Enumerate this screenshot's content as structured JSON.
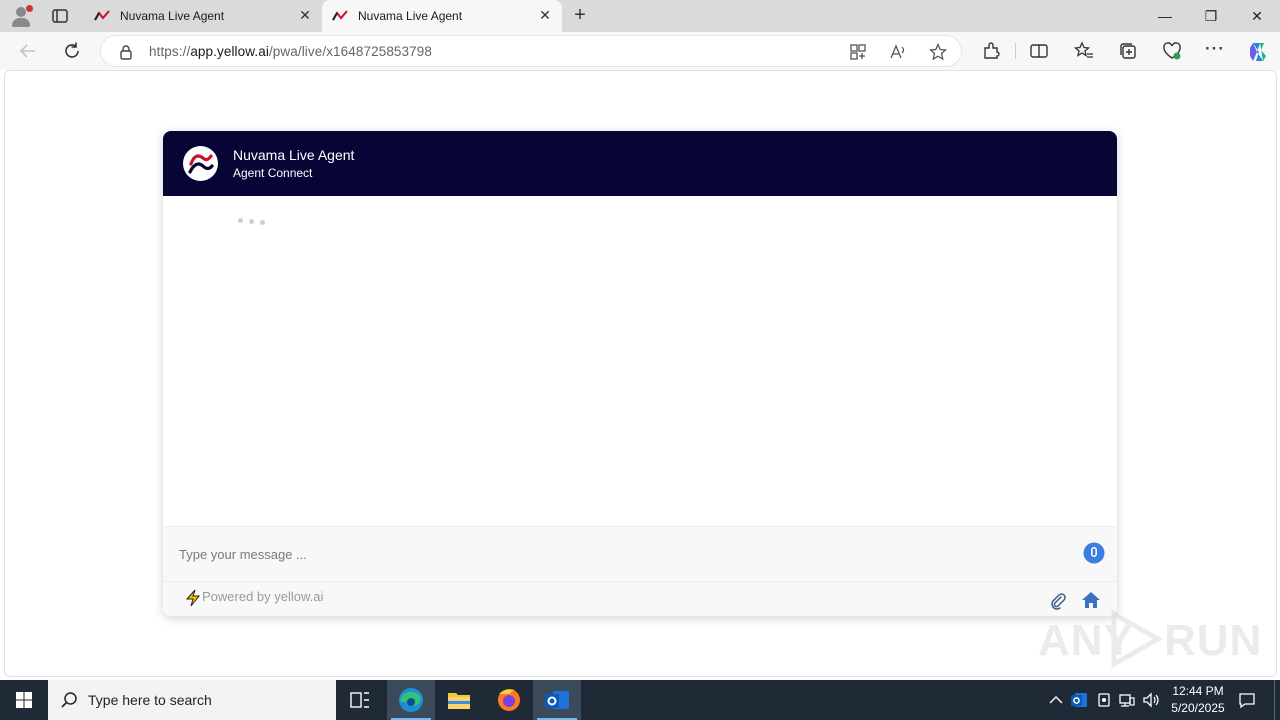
{
  "browser": {
    "tabs": [
      {
        "title": "Nuvama Live Agent",
        "active": false
      },
      {
        "title": "Nuvama Live Agent",
        "active": true
      }
    ],
    "close_glyph": "✕",
    "new_tab_glyph": "+",
    "url_prefix": "https://",
    "url_host": "app.yellow.ai",
    "url_path": "/pwa/live/x1648725853798",
    "window_controls": {
      "minimize": "—",
      "restore": "❐",
      "close": "✕"
    }
  },
  "chat": {
    "header_title": "Nuvama Live Agent",
    "header_subtitle": "Agent Connect",
    "brand_color": "#060535",
    "input_placeholder": "Type your message ...",
    "powered_by": "Powered by yellow.ai",
    "icons": [
      "mic-icon",
      "bolt-icon",
      "attachment-icon",
      "home-icon"
    ]
  },
  "watermark": {
    "left": "ANY",
    "right": "RUN"
  },
  "taskbar": {
    "search_placeholder": "Type here to search",
    "apps": [
      "task-view",
      "edge",
      "file-explorer",
      "firefox",
      "outlook"
    ],
    "clock_time": "12:44 PM",
    "clock_date": "5/20/2025"
  }
}
